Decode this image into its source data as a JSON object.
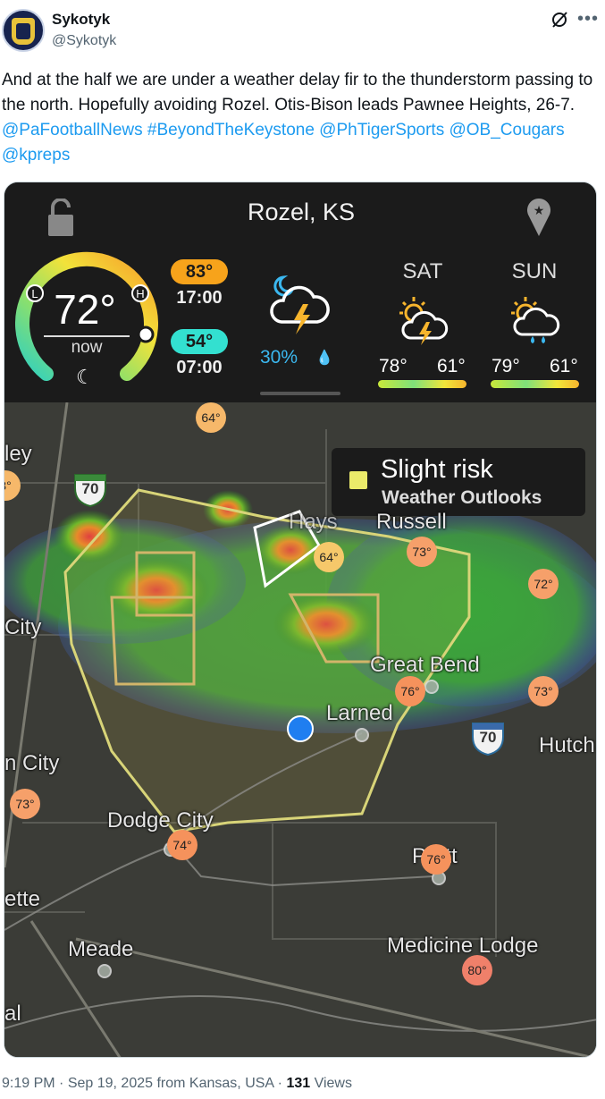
{
  "tweet": {
    "display_name": "Sykotyk",
    "handle": "@Sykotyk",
    "text_plain": "And at the half we are under a weather delay fir to the thunderstorm passing to the north. Hopefully avoiding Rozel. Otis-Bison leads Pawnee Heights, 26-7.",
    "mentions": [
      "@PaFootballNews",
      "#BeyondTheKeystone",
      "@PhTigerSports",
      "@OB_Cougars",
      "@kpreps"
    ],
    "time": "9:19 PM",
    "date": "Sep 19, 2025",
    "from": "from Kansas, USA",
    "views_count": "131",
    "views_label": "Views",
    "sep": "·"
  },
  "weather": {
    "location": "Rozel, KS",
    "current_temp": "72°",
    "now_label": "now",
    "gauge_low_marker": "L",
    "gauge_high_marker": "H",
    "high_temp": "83°",
    "high_time": "17:00",
    "low_temp": "54°",
    "low_time": "07:00",
    "precip_chance": "30%",
    "forecast": [
      {
        "day": "SAT",
        "hi": "78°",
        "lo": "61°",
        "icon": "sun-cloud-lightning-icon"
      },
      {
        "day": "SUN",
        "hi": "79°",
        "lo": "61°",
        "icon": "sun-cloud-rain-icon"
      }
    ],
    "colors": {
      "high": "#f7a31b",
      "low": "#33e0d0",
      "precip": "#3bb8f0"
    }
  },
  "map": {
    "legend_title": "Slight risk",
    "legend_subtitle": "Weather Outlooks",
    "legend_color": "#eaea6a",
    "cities": [
      "ley",
      "City",
      "Hays",
      "Russell",
      "Great Bend",
      "Larned",
      "Hutch",
      "n City",
      "Dodge City",
      "Pratt",
      "ette",
      "Meade",
      "Medicine Lodge",
      "al"
    ],
    "temps": [
      "64°",
      "8°",
      "64°",
      "73°",
      "72°",
      "76°",
      "73°",
      "73°",
      "74°",
      "76°",
      "80°"
    ],
    "interstate": [
      "70",
      "70"
    ]
  }
}
